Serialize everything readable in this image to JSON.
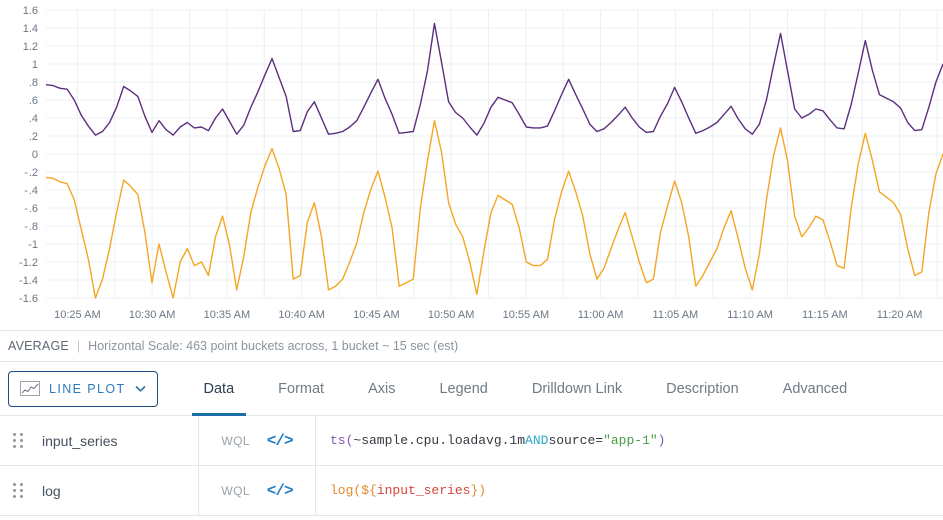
{
  "chart_data": {
    "type": "line",
    "title": "",
    "xlabel": "",
    "ylabel": "",
    "ylim": [
      -1.6,
      1.6
    ],
    "ytick_labels": [
      "1.6",
      "1.4",
      "1.2",
      "1",
      " .8",
      ".6",
      ".4",
      ".2",
      "0",
      "- .2",
      "- .4",
      "- .6",
      "- .8",
      "-1",
      "-1.2",
      "-1.4",
      "-1.6"
    ],
    "ytick_values": [
      1.6,
      1.4,
      1.2,
      1.0,
      0.8,
      0.6,
      0.4,
      0.2,
      0,
      -0.2,
      -0.4,
      -0.6,
      -0.8,
      -1.0,
      -1.2,
      -1.4,
      -1.6
    ],
    "xtick_labels": [
      "10:25 AM",
      "10:30 AM",
      "10:35 AM",
      "10:40 AM",
      "10:45 AM",
      "10:50 AM",
      "10:55 AM",
      "11:00 AM",
      "11:05 AM",
      "11:10 AM",
      "11:15 AM",
      "11:20 AM"
    ],
    "grid": true,
    "legend_position": "none",
    "series": [
      {
        "name": "input_series",
        "color": "#5b2f7e",
        "values": [
          0.77,
          0.76,
          0.73,
          0.72,
          0.6,
          0.43,
          0.31,
          0.21,
          0.25,
          0.35,
          0.52,
          0.75,
          0.7,
          0.64,
          0.42,
          0.24,
          0.37,
          0.27,
          0.21,
          0.3,
          0.35,
          0.29,
          0.3,
          0.26,
          0.4,
          0.5,
          0.36,
          0.22,
          0.32,
          0.52,
          0.69,
          0.88,
          1.06,
          0.85,
          0.64,
          0.25,
          0.26,
          0.47,
          0.58,
          0.4,
          0.22,
          0.23,
          0.25,
          0.3,
          0.37,
          0.52,
          0.68,
          0.83,
          0.62,
          0.44,
          0.23,
          0.24,
          0.25,
          0.55,
          0.92,
          1.45,
          1.02,
          0.58,
          0.46,
          0.4,
          0.3,
          0.21,
          0.34,
          0.52,
          0.63,
          0.6,
          0.57,
          0.44,
          0.3,
          0.29,
          0.29,
          0.31,
          0.48,
          0.66,
          0.83,
          0.66,
          0.5,
          0.33,
          0.25,
          0.28,
          0.35,
          0.43,
          0.52,
          0.4,
          0.3,
          0.24,
          0.25,
          0.42,
          0.56,
          0.74,
          0.58,
          0.4,
          0.23,
          0.26,
          0.3,
          0.35,
          0.44,
          0.53,
          0.39,
          0.28,
          0.22,
          0.33,
          0.6,
          0.98,
          1.34,
          0.92,
          0.5,
          0.4,
          0.44,
          0.5,
          0.48,
          0.38,
          0.29,
          0.28,
          0.55,
          0.9,
          1.26,
          0.93,
          0.66,
          0.62,
          0.58,
          0.51,
          0.35,
          0.26,
          0.27,
          0.52,
          0.8,
          1.0
        ]
      },
      {
        "name": "log",
        "color": "#f5a623",
        "values": [
          -0.26,
          -0.27,
          -0.31,
          -0.33,
          -0.51,
          -0.84,
          -1.17,
          -1.6,
          -1.39,
          -1.05,
          -0.65,
          -0.29,
          -0.36,
          -0.45,
          -0.87,
          -1.43,
          -1.0,
          -1.31,
          -1.6,
          -1.2,
          -1.05,
          -1.24,
          -1.2,
          -1.35,
          -0.92,
          -0.69,
          -1.02,
          -1.51,
          -1.14,
          -0.65,
          -0.37,
          -0.13,
          0.06,
          -0.16,
          -0.45,
          -1.39,
          -1.35,
          -0.76,
          -0.54,
          -0.92,
          -1.51,
          -1.47,
          -1.39,
          -1.2,
          -0.99,
          -0.65,
          -0.39,
          -0.19,
          -0.48,
          -0.82,
          -1.47,
          -1.43,
          -1.39,
          -0.6,
          -0.08,
          0.37,
          0.02,
          -0.54,
          -0.78,
          -0.92,
          -1.2,
          -1.56,
          -1.08,
          -0.65,
          -0.46,
          -0.51,
          -0.56,
          -0.82,
          -1.2,
          -1.24,
          -1.24,
          -1.17,
          -0.73,
          -0.42,
          -0.19,
          -0.42,
          -0.69,
          -1.11,
          -1.39,
          -1.27,
          -1.05,
          -0.84,
          -0.65,
          -0.92,
          -1.2,
          -1.43,
          -1.39,
          -0.87,
          -0.58,
          -0.3,
          -0.54,
          -0.92,
          -1.47,
          -1.35,
          -1.2,
          -1.05,
          -0.82,
          -0.63,
          -0.94,
          -1.27,
          -1.51,
          -1.11,
          -0.51,
          -0.02,
          0.29,
          -0.08,
          -0.69,
          -0.92,
          -0.82,
          -0.69,
          -0.73,
          -0.97,
          -1.24,
          -1.27,
          -0.6,
          -0.11,
          0.23,
          -0.07,
          -0.42,
          -0.48,
          -0.54,
          -0.67,
          -1.05,
          -1.35,
          -1.31,
          -0.65,
          -0.22,
          0.0
        ]
      }
    ]
  },
  "status": {
    "aggregation": "AVERAGE",
    "separator": "|",
    "scale_text": "Horizontal Scale: 463 point buckets across, 1 bucket ~ 15 sec (est)"
  },
  "toolbar": {
    "plot_type_label": "LINE PLOT",
    "plot_type_icon": "line-chart-icon",
    "chevron_icon": "chevron-down-icon",
    "tabs": [
      {
        "label": "Data",
        "active": true
      },
      {
        "label": "Format",
        "active": false
      },
      {
        "label": "Axis",
        "active": false
      },
      {
        "label": "Legend",
        "active": false
      },
      {
        "label": "Drilldown Link",
        "active": false
      },
      {
        "label": "Description",
        "active": false
      },
      {
        "label": "Advanced",
        "active": false
      }
    ]
  },
  "queries": [
    {
      "name": "input_series",
      "language": "WQL",
      "code_icon": "</>",
      "query_tokens": [
        {
          "text": "ts(",
          "type": "fn"
        },
        {
          "text": "~sample.cpu.loadavg.1m",
          "type": "metric"
        },
        {
          "text": " ",
          "type": "plain"
        },
        {
          "text": "AND",
          "type": "kw"
        },
        {
          "text": " source=",
          "type": "plain"
        },
        {
          "text": "\"app-1\"",
          "type": "str"
        },
        {
          "text": ")",
          "type": "fn"
        }
      ],
      "query_text": "ts(~sample.cpu.loadavg.1m AND source=\"app-1\")"
    },
    {
      "name": "log",
      "language": "WQL",
      "code_icon": "</>",
      "query_tokens": [
        {
          "text": "log(",
          "type": "orange"
        },
        {
          "text": "${",
          "type": "orange"
        },
        {
          "text": "input_series",
          "type": "var"
        },
        {
          "text": "}",
          "type": "orange"
        },
        {
          "text": ")",
          "type": "orange"
        }
      ],
      "query_text": "log(${input_series})"
    }
  ],
  "colors": {
    "series_purple": "#5b2f7e",
    "series_orange": "#f5a623",
    "accent_blue": "#1a6ea8",
    "grid": "#eceff1"
  }
}
